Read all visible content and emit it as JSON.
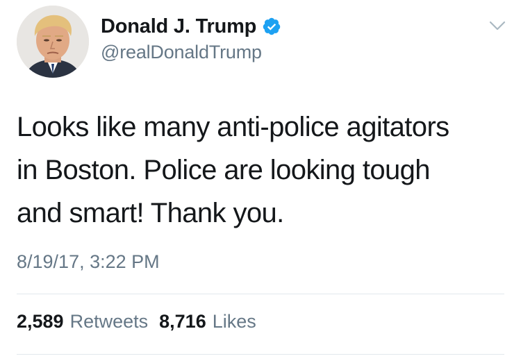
{
  "author": {
    "display_name": "Donald J. Trump",
    "handle": "@realDonaldTrump",
    "verified": true,
    "verified_icon": "verified-badge-icon",
    "verified_color": "#1da1f2"
  },
  "tweet": {
    "text": "Looks like many anti-police agitators\nin Boston. Police are looking tough\nand smart! Thank you.",
    "timestamp": "8/19/17, 3:22 PM"
  },
  "stats": {
    "retweets_count": "2,589",
    "retweets_label": "Retweets",
    "likes_count": "8,716",
    "likes_label": "Likes"
  },
  "menu": {
    "icon": "chevron-down-icon"
  },
  "colors": {
    "text_primary": "#14171a",
    "text_secondary": "#657786",
    "divider": "#e1e8ed"
  }
}
